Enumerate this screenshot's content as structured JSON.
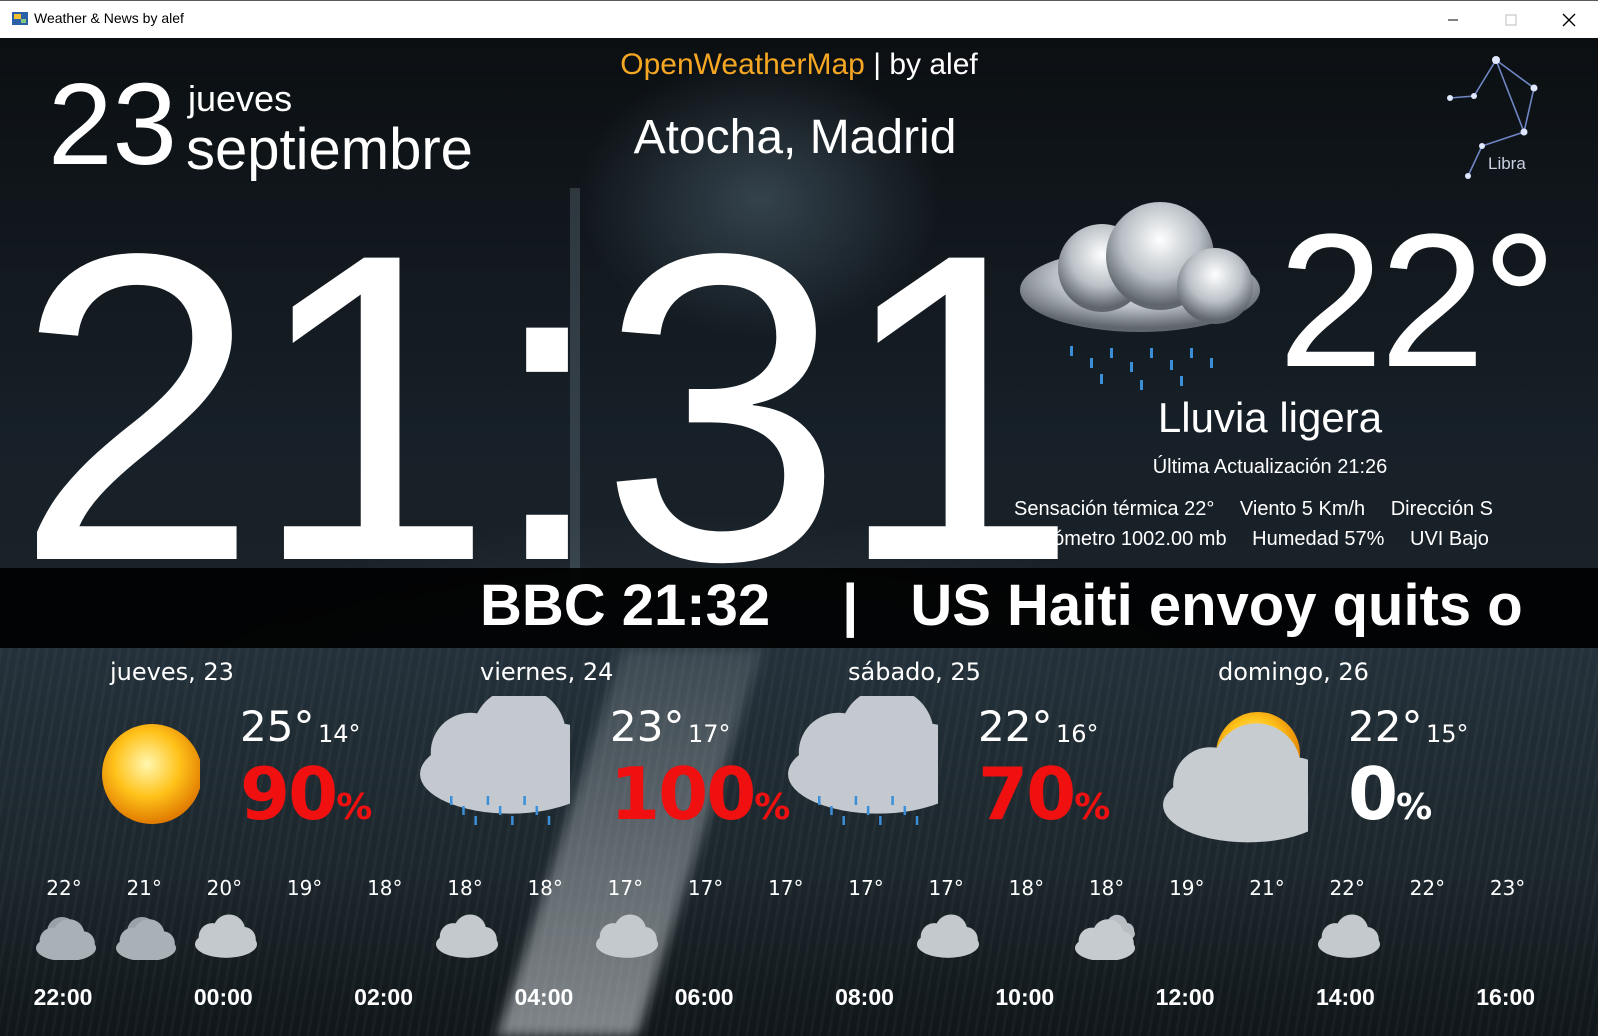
{
  "window": {
    "title": "Weather & News by alef"
  },
  "header": {
    "provider": "OpenWeatherMap",
    "separator": "|",
    "author": "by alef",
    "location": "Atocha, Madrid"
  },
  "date": {
    "day_number": "23",
    "weekday": "jueves",
    "month": "septiembre"
  },
  "clock": {
    "time": "21:31"
  },
  "zodiac": {
    "name": "Libra"
  },
  "current": {
    "temperature": "22°",
    "description": "Lluvia ligera",
    "updated": "Última Actualización 21:26",
    "feels_like": "Sensación térmica 22°",
    "wind": "Viento 5 Km/h",
    "direction": "Dirección S",
    "pressure": "Barómetro 1002.00 mb",
    "humidity": "Humedad 57%",
    "uvi": "UVI Bajo",
    "icon": "rain-cloud-icon"
  },
  "ticker": {
    "source_time": "BBC 21:32",
    "separator": "|",
    "headline": "US Haiti envoy quits o"
  },
  "forecast": [
    {
      "label": "jueves, 23",
      "hi": "25°",
      "lo": "14°",
      "pop": "90",
      "unit": "%",
      "icon": "sun-icon"
    },
    {
      "label": "viernes, 24",
      "hi": "23°",
      "lo": "17°",
      "pop": "100",
      "unit": "%",
      "icon": "rain-cloud-icon"
    },
    {
      "label": "sábado, 25",
      "hi": "22°",
      "lo": "16°",
      "pop": "70",
      "unit": "%",
      "icon": "rain-cloud-icon"
    },
    {
      "label": "domingo, 26",
      "hi": "22°",
      "lo": "15°",
      "pop": "0",
      "unit": "%",
      "icon": "partly-cloudy-icon"
    }
  ],
  "hourly_temps": [
    "22°",
    "21°",
    "20°",
    "19°",
    "18°",
    "18°",
    "18°",
    "17°",
    "17°",
    "17°",
    "17°",
    "17°",
    "18°",
    "18°",
    "19°",
    "21°",
    "22°",
    "22°",
    "23°"
  ],
  "hourly_icons": [
    "moon-cloud-icon",
    "moon-cloud-icon",
    "cloud-icon",
    "",
    "",
    "cloud-icon",
    "",
    "cloud-icon",
    "",
    "",
    "",
    "cloud-icon",
    "",
    "clouds-icon",
    "",
    "",
    "cloud-icon",
    "",
    ""
  ],
  "hourly_times": [
    "22:00",
    "00:00",
    "02:00",
    "04:00",
    "06:00",
    "08:00",
    "10:00",
    "12:00",
    "14:00",
    "16:00"
  ],
  "colors": {
    "provider": "#f5a623",
    "pop_high": "#f01010",
    "pop_zero": "#ffffff"
  }
}
